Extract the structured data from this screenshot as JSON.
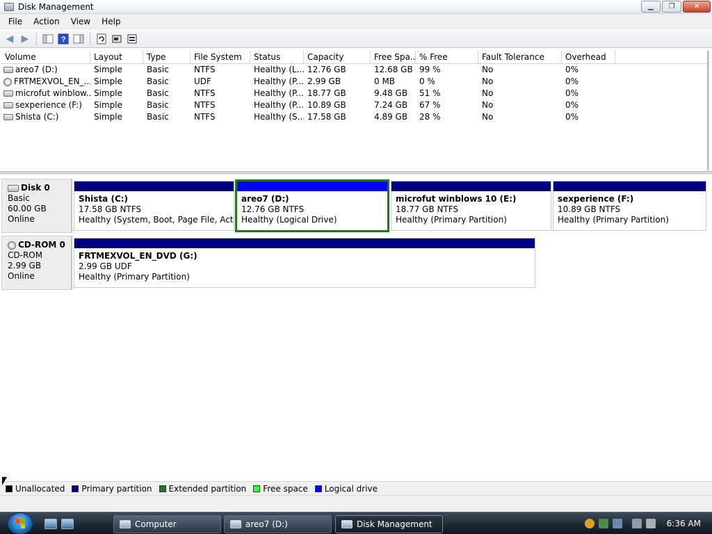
{
  "window": {
    "title": "Disk Management"
  },
  "menu": [
    "File",
    "Action",
    "View",
    "Help"
  ],
  "toolbar": {
    "buttons": [
      "back-icon",
      "forward-icon",
      "console-tree-icon",
      "help-icon",
      "properties-icon",
      "refresh-icon",
      "disk-properties-icon",
      "rescan-icon"
    ]
  },
  "volume_list": {
    "columns": [
      "Volume",
      "Layout",
      "Type",
      "File System",
      "Status",
      "Capacity",
      "Free Spa...",
      "% Free",
      "Fault Tolerance",
      "Overhead"
    ],
    "rows": [
      {
        "icon": "disk",
        "cells": [
          "areo7 (D:)",
          "Simple",
          "Basic",
          "NTFS",
          "Healthy (L...",
          "12.76 GB",
          "12.68 GB",
          "99 %",
          "No",
          "0%"
        ]
      },
      {
        "icon": "cdrom",
        "cells": [
          "FRTMEXVOL_EN_...",
          "Simple",
          "Basic",
          "UDF",
          "Healthy (P...",
          "2.99 GB",
          "0 MB",
          "0 %",
          "No",
          "0%"
        ]
      },
      {
        "icon": "disk",
        "cells": [
          "microfut winblow...",
          "Simple",
          "Basic",
          "NTFS",
          "Healthy (P...",
          "18.77 GB",
          "9.48 GB",
          "51 %",
          "No",
          "0%"
        ]
      },
      {
        "icon": "disk",
        "cells": [
          "sexperience (F:)",
          "Simple",
          "Basic",
          "NTFS",
          "Healthy (P...",
          "10.89 GB",
          "7.24 GB",
          "67 %",
          "No",
          "0%"
        ]
      },
      {
        "icon": "disk",
        "cells": [
          "Shista (C:)",
          "Simple",
          "Basic",
          "NTFS",
          "Healthy (S...",
          "17.58 GB",
          "4.89 GB",
          "28 %",
          "No",
          "0%"
        ]
      }
    ]
  },
  "disks": [
    {
      "name": "Disk 0",
      "type": "Basic",
      "size": "60.00 GB",
      "status": "Online",
      "partitions": [
        {
          "name": "Shista  (C:)",
          "size": "17.58 GB NTFS",
          "status": "Healthy (System, Boot, Page File, Active,",
          "kind": "primary"
        },
        {
          "name": "areo7  (D:)",
          "size": "12.76 GB NTFS",
          "status": "Healthy (Logical Drive)",
          "kind": "logical"
        },
        {
          "name": "microfut winblows 10  (E:)",
          "size": "18.77 GB NTFS",
          "status": "Healthy (Primary Partition)",
          "kind": "primary"
        },
        {
          "name": "sexperience  (F:)",
          "size": "10.89 GB NTFS",
          "status": "Healthy (Primary Partition)",
          "kind": "primary"
        }
      ]
    },
    {
      "name": "CD-ROM 0",
      "type": "CD-ROM",
      "size": "2.99 GB",
      "status": "Online",
      "partitions": [
        {
          "name": "FRTMEXVOL_EN_DVD  (G:)",
          "size": "2.99 GB UDF",
          "status": "Healthy (Primary Partition)",
          "kind": "primary"
        }
      ]
    }
  ],
  "legend": [
    {
      "label": "Unallocated",
      "color": "#000000"
    },
    {
      "label": "Primary partition",
      "color": "#00007f"
    },
    {
      "label": "Extended partition",
      "color": "#1f7a1f"
    },
    {
      "label": "Free space",
      "color": "#33ff33"
    },
    {
      "label": "Logical drive",
      "color": "#0000ff"
    }
  ],
  "taskbar": {
    "buttons": [
      {
        "label": "Computer",
        "active": false
      },
      {
        "label": "areo7 (D:)",
        "active": false
      },
      {
        "label": "Disk Management",
        "active": true
      }
    ],
    "clock": "6:36 AM"
  }
}
